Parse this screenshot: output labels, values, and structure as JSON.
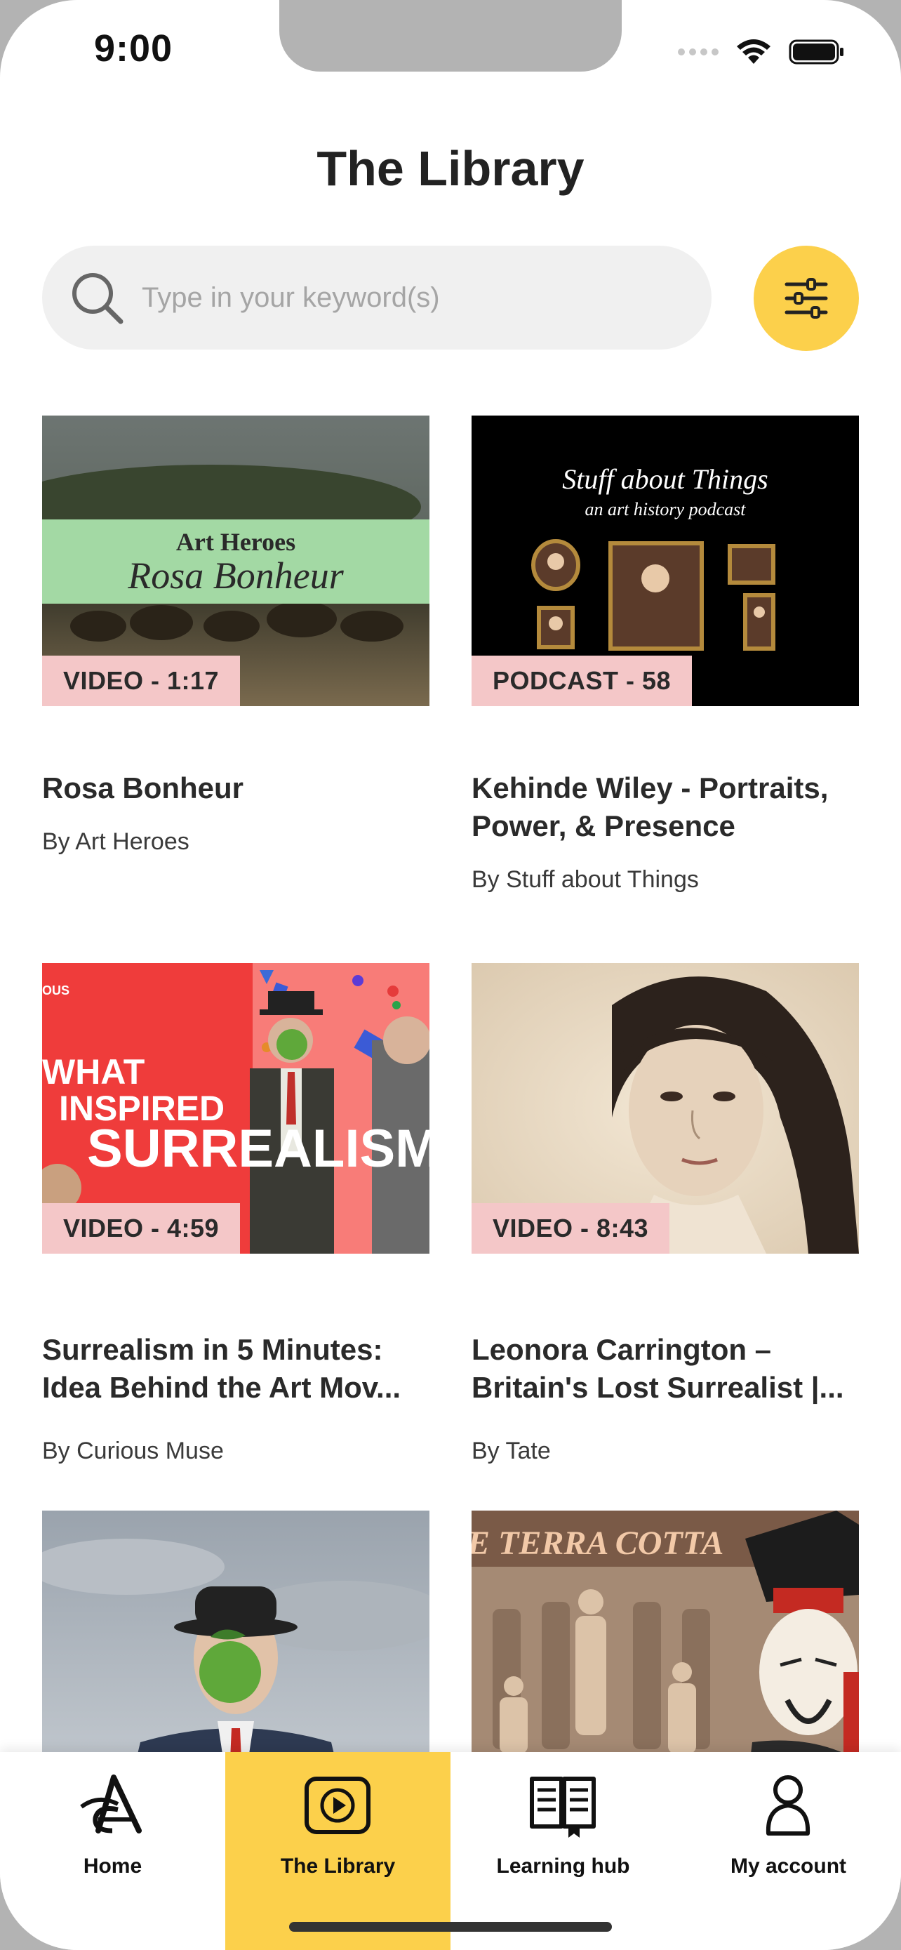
{
  "status_bar": {
    "time": "9:00"
  },
  "header": {
    "title": "The Library"
  },
  "search": {
    "placeholder": "Type in your keyword(s)"
  },
  "cards": [
    {
      "badge": "VIDEO - 1:17",
      "title": "Rosa Bonheur",
      "author": "By Art Heroes",
      "thumb_text": [
        "Art Heroes",
        "Rosa Bonheur"
      ]
    },
    {
      "badge": "PODCAST - 58",
      "title": "Kehinde Wiley - Portraits, Power, & Presence",
      "author": "By Stuff about Things",
      "thumb_text": [
        "Stuff about Things",
        "an art history podcast"
      ]
    },
    {
      "badge": "VIDEO - 4:59",
      "title": "Surrealism in 5 Minutes: Idea Behind the Art Mov...",
      "author": "By Curious Muse",
      "thumb_text": [
        "OUS",
        "WHAT",
        "INSPIRED",
        "SURREALISM"
      ]
    },
    {
      "badge": "VIDEO - 8:43",
      "title": "Leonora Carrington – Britain's Lost Surrealist |...",
      "author": "By Tate"
    },
    {
      "title": ""
    },
    {
      "thumb_text": [
        "E TERRA COTTA"
      ]
    }
  ],
  "tabbar": {
    "items": [
      {
        "label": "Home",
        "icon": "art-logo-icon"
      },
      {
        "label": "The Library",
        "icon": "play-icon",
        "active": true
      },
      {
        "label": "Learning hub",
        "icon": "book-icon"
      },
      {
        "label": "My account",
        "icon": "person-icon"
      }
    ]
  },
  "colors": {
    "accent": "#fcd04b",
    "badge": "#f4c7c8",
    "search_bg": "#f0f0f0"
  }
}
